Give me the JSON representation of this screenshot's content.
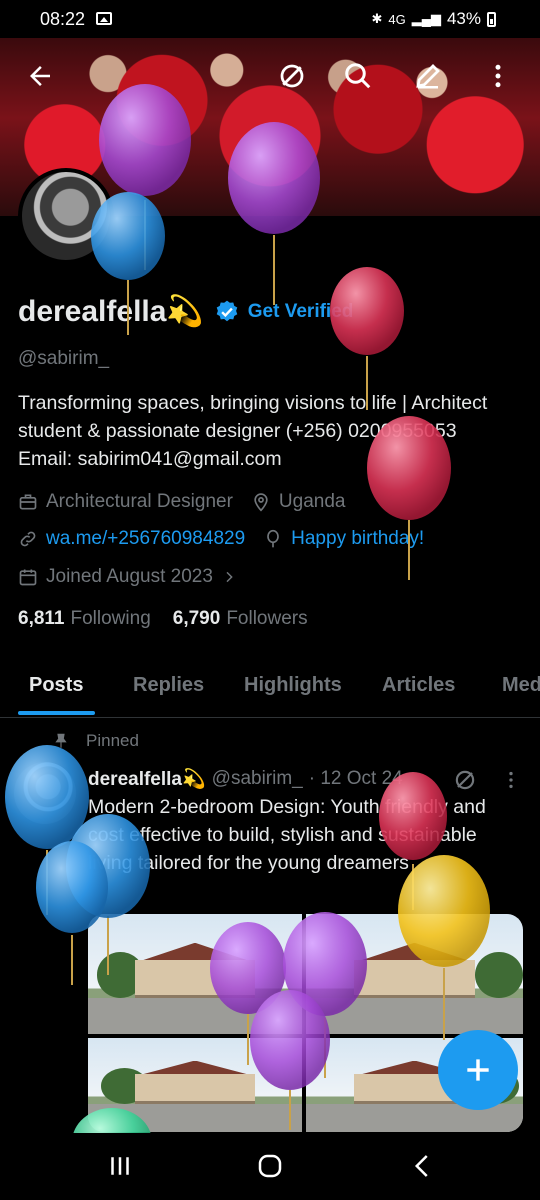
{
  "status_bar": {
    "time": "08:22",
    "network": "4G",
    "battery": "43%"
  },
  "header": {
    "back_icon": "arrow-left-icon",
    "grok_icon": "grok-icon",
    "search_icon": "search-icon",
    "edit_icon": "pencil-icon",
    "more_icon": "more-vertical-icon"
  },
  "profile": {
    "display_name": "derealfella💫",
    "get_verified": "Get Verified",
    "handle": "@sabirim_",
    "bio": "Transforming spaces, bringing visions to life | Architect student & passionate designer (+256) 0200955053 Email: sabirim041@gmail.com",
    "category": "Architectural Designer",
    "location": "Uganda",
    "website": "wa.me/+256760984829",
    "birthday": "Happy birthday!",
    "joined": "Joined August 2023",
    "following_count": "6,811",
    "following_label": "Following",
    "followers_count": "6,790",
    "followers_label": "Followers"
  },
  "tabs": [
    "Posts",
    "Replies",
    "Highlights",
    "Articles",
    "Media"
  ],
  "active_tab": "Posts",
  "pinned_post": {
    "pinned_label": "Pinned",
    "author": "derealfella💫",
    "handle": "@sabirim_",
    "date": "· 12 Oct 24",
    "text": "Modern 2-bedroom Design: Youth friendly and cost effective to build, stylish and sustainable living tailored for the young dreamers"
  },
  "colors": {
    "accent": "#1d9bf0",
    "background": "#000000",
    "muted_text": "#71767b",
    "balloon_purple": "#a64bd9",
    "balloon_blue": "#2f96e6",
    "balloon_red": "#e03558",
    "balloon_yellow": "#f3c21a"
  },
  "fab_icon": "plus-icon",
  "nav": {
    "recent_icon": "recent-apps-icon",
    "home_icon": "home-icon",
    "back_icon": "back-chevron-icon"
  }
}
